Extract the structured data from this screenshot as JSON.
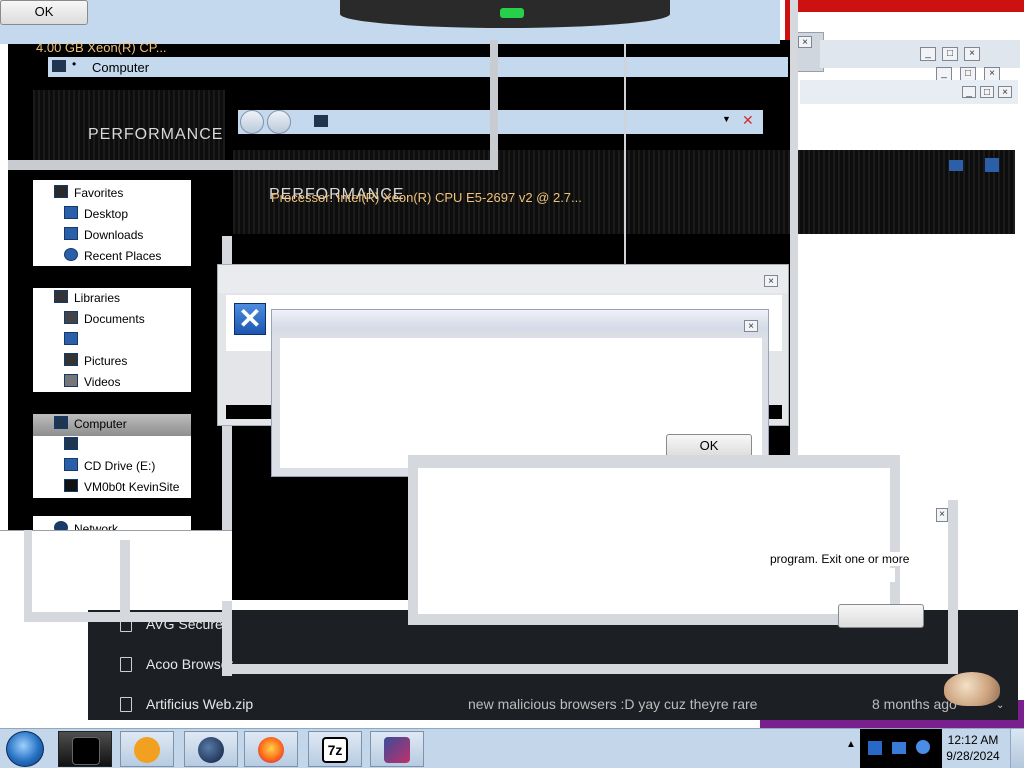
{
  "top_dialog": {
    "ok_label": "OK"
  },
  "explorer": {
    "cpu_short": "4.00 GB Xeon(R) CP...",
    "breadcrumb_label": "Computer",
    "banner_text": "PERFORMANCE",
    "processor_text": "Processor: Intel(R) Xeon(R) CPU E5-2697 v2 @ 2.7..."
  },
  "nav": {
    "favorites": {
      "label": "Favorites",
      "items": [
        "Desktop",
        "Downloads",
        "Recent Places"
      ]
    },
    "libraries": {
      "label": "Libraries",
      "items": [
        "Documents",
        "",
        "Pictures",
        "Videos"
      ]
    },
    "computer": {
      "label": "Computer",
      "items": [
        "",
        "CD Drive (E:)",
        "VM0b0t KevinSite"
      ]
    },
    "network": {
      "label": "Network"
    }
  },
  "error_dialog": {
    "ok_label": "OK",
    "message_fragment": "program. Exit one or more"
  },
  "file_list": {
    "rows": [
      {
        "name": "AVG Secure",
        "description": "",
        "date": ""
      },
      {
        "name": "Acoo Browser",
        "description": "",
        "date": ""
      },
      {
        "name": "Artificius Web.zip",
        "description": "new malicious browsers :D yay cuz theyre rare",
        "date": "8 months ago"
      }
    ]
  },
  "taskbar": {
    "time": "12:12 AM",
    "date": "9/28/2024",
    "tasks": [
      "explorer",
      "media-player",
      "browser-globe",
      "firefox",
      "7zip",
      "installer"
    ],
    "icons": {
      "7zip": "7z"
    }
  },
  "colors": {
    "titlebar_blue": "#c4d9ee",
    "taskbar": "#c3d6ea",
    "red_background": "#cc1111",
    "purple_background": "#7a1f8e"
  }
}
